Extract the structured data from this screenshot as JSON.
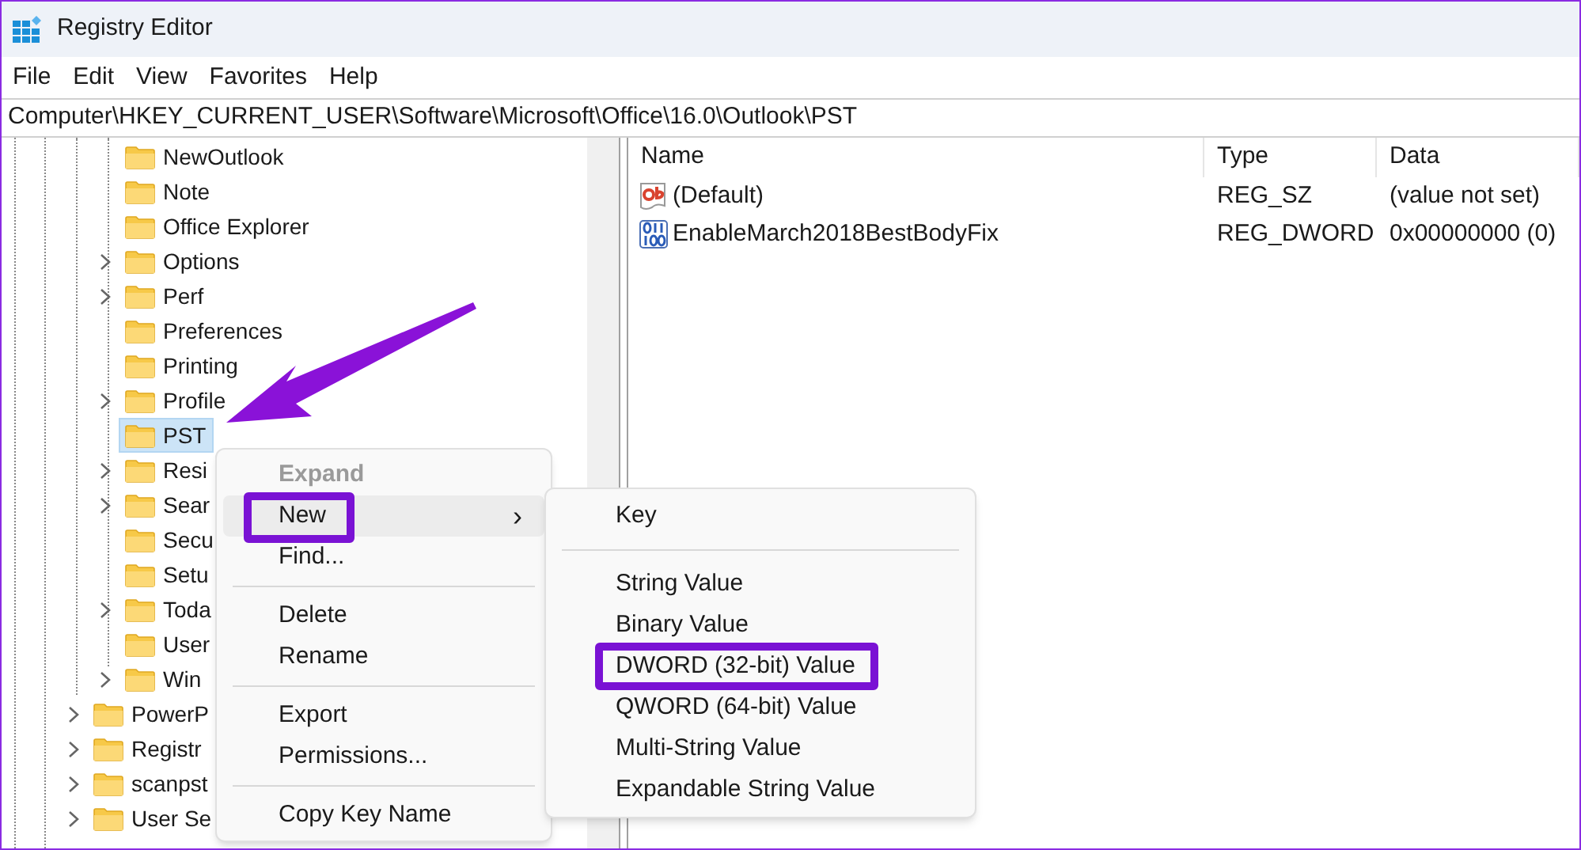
{
  "window": {
    "title": "Registry Editor"
  },
  "menu_bar": [
    "File",
    "Edit",
    "View",
    "Favorites",
    "Help"
  ],
  "address": "Computer\\HKEY_CURRENT_USER\\Software\\Microsoft\\Office\\16.0\\Outlook\\PST",
  "tree": {
    "items": [
      {
        "children": [
          {
            "label": "NewOutlook",
            "expandable": false,
            "selected": false
          },
          {
            "label": "Note",
            "expandable": false,
            "selected": false
          },
          {
            "label": "Office Explorer",
            "expandable": false,
            "selected": false
          },
          {
            "label": "Options",
            "expandable": true,
            "selected": false
          },
          {
            "label": "Perf",
            "expandable": true,
            "selected": false
          },
          {
            "label": "Preferences",
            "expandable": false,
            "selected": false
          },
          {
            "label": "Printing",
            "expandable": false,
            "selected": false
          },
          {
            "label": "Profile",
            "expandable": true,
            "selected": false
          },
          {
            "label": "PST",
            "expandable": false,
            "selected": true
          },
          {
            "label": "Resi",
            "expandable": true,
            "selected": false
          },
          {
            "label": "Sear",
            "expandable": true,
            "selected": false
          },
          {
            "label": "Secu",
            "expandable": false,
            "selected": false
          },
          {
            "label": "Setu",
            "expandable": false,
            "selected": false
          },
          {
            "label": "Toda",
            "expandable": true,
            "selected": false
          },
          {
            "label": "User",
            "expandable": false,
            "selected": false
          },
          {
            "label": "Win",
            "expandable": true,
            "selected": false
          }
        ]
      },
      {
        "label": "PowerP",
        "expandable": true,
        "selected": false
      },
      {
        "label": "Registr",
        "expandable": true,
        "selected": false
      },
      {
        "label": "scanpst",
        "expandable": true,
        "selected": false
      },
      {
        "label": "User Se",
        "expandable": true,
        "selected": false
      }
    ]
  },
  "values_table": {
    "columns": [
      "Name",
      "Type",
      "Data"
    ],
    "rows": [
      {
        "kind": "string",
        "name": "(Default)",
        "type": "REG_SZ",
        "data": "(value not set)"
      },
      {
        "kind": "binary",
        "name": "EnableMarch2018BestBodyFix",
        "type": "REG_DWORD",
        "data": "0x00000000 (0)"
      }
    ]
  },
  "context_menu": {
    "items": [
      {
        "kind": "item",
        "label": "Expand",
        "disabled": true,
        "highlighted": false,
        "annotated": false
      },
      {
        "kind": "item",
        "label": "New",
        "disabled": false,
        "highlighted": true,
        "annotated": true,
        "submenu_arrow": "›"
      },
      {
        "kind": "item",
        "label": "Find...",
        "disabled": false,
        "highlighted": false,
        "annotated": false
      },
      {
        "kind": "separator"
      },
      {
        "kind": "item",
        "label": "Delete",
        "disabled": false,
        "highlighted": false,
        "annotated": false
      },
      {
        "kind": "item",
        "label": "Rename",
        "disabled": false,
        "highlighted": false,
        "annotated": false
      },
      {
        "kind": "separator"
      },
      {
        "kind": "item",
        "label": "Export",
        "disabled": false,
        "highlighted": false,
        "annotated": false
      },
      {
        "kind": "item",
        "label": "Permissions...",
        "disabled": false,
        "highlighted": false,
        "annotated": false
      },
      {
        "kind": "separator"
      },
      {
        "kind": "item",
        "label": "Copy Key Name",
        "disabled": false,
        "highlighted": false,
        "annotated": false
      }
    ]
  },
  "submenu": {
    "items": [
      {
        "kind": "item",
        "label": "Key",
        "annotated": false
      },
      {
        "kind": "separator"
      },
      {
        "kind": "item",
        "label": "String Value",
        "annotated": false
      },
      {
        "kind": "item",
        "label": "Binary Value",
        "annotated": false
      },
      {
        "kind": "item",
        "label": "DWORD (32-bit) Value",
        "annotated": true
      },
      {
        "kind": "item",
        "label": "QWORD (64-bit) Value",
        "annotated": false
      },
      {
        "kind": "item",
        "label": "Multi-String Value",
        "annotated": false
      },
      {
        "kind": "item",
        "label": "Expandable String Value",
        "annotated": false
      }
    ]
  },
  "annotation_arrow": {
    "shown": true
  }
}
